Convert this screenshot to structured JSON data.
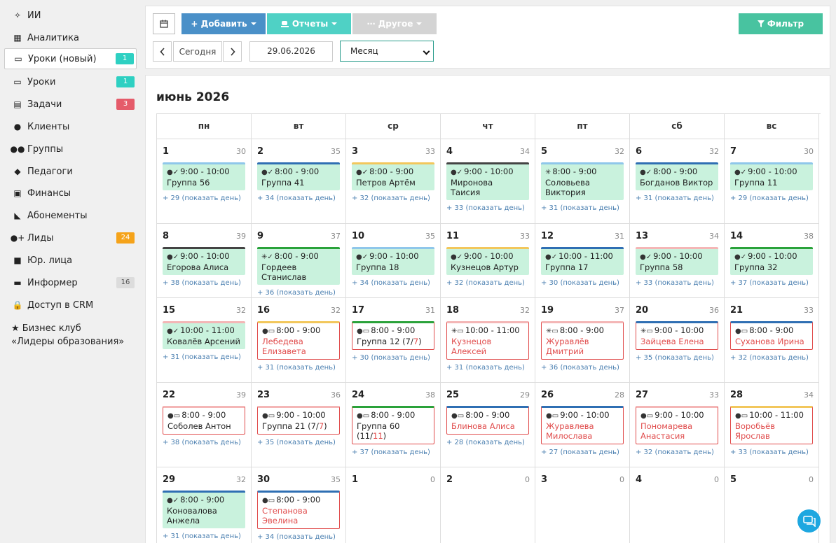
{
  "sidebar": {
    "items": [
      {
        "icon": "sparkles-icon",
        "glyph": "✧",
        "label": "ИИ"
      },
      {
        "icon": "map-icon",
        "glyph": "▦",
        "label": "Аналитика"
      },
      {
        "icon": "calendar-icon",
        "glyph": "▭",
        "label": "Уроки (новый)",
        "badge": "1",
        "badge_color": "teal"
      },
      {
        "icon": "calendar-icon",
        "glyph": "▭",
        "label": "Уроки",
        "badge": "1",
        "badge_color": "teal"
      },
      {
        "icon": "clipboard-icon",
        "glyph": "▤",
        "label": "Задачи",
        "badge": "3",
        "badge_color": "red"
      },
      {
        "icon": "user-icon",
        "glyph": "●",
        "label": "Клиенты"
      },
      {
        "icon": "users-icon",
        "glyph": "●●",
        "label": "Группы"
      },
      {
        "icon": "graduation-cap-icon",
        "glyph": "◆",
        "label": "Педагоги"
      },
      {
        "icon": "money-icon",
        "glyph": "▣",
        "label": "Финансы"
      },
      {
        "icon": "tag-icon",
        "glyph": "◣",
        "label": "Абонементы"
      },
      {
        "icon": "user-plus-icon",
        "glyph": "●+",
        "label": "Лиды",
        "badge": "24",
        "badge_color": "orange"
      },
      {
        "icon": "briefcase-icon",
        "glyph": "■",
        "label": "Юр. лица"
      },
      {
        "icon": "newspaper-icon",
        "glyph": "▬",
        "label": "Информер",
        "badge": "16",
        "badge_color": "gray"
      },
      {
        "icon": "lock-icon",
        "glyph": "🔒",
        "label": "Доступ в CRM"
      }
    ],
    "club_line1": "★ Бизнес клуб",
    "club_line2": "«Лидеры образования»"
  },
  "toolbar": {
    "add_label": "+ Добавить",
    "reports_label": "Отчеты",
    "other_label": "Другое",
    "filter_label": "Фильтр",
    "today_label": "Сегодня",
    "date_value": "29.06.2026",
    "view_value": "Месяц"
  },
  "calendar": {
    "title": "июнь 2026",
    "weekdays": [
      "пн",
      "вт",
      "ср",
      "чт",
      "пт",
      "сб",
      "вс"
    ],
    "colors": {
      "green": "#c9f2dd",
      "red": "#e04b4b",
      "link": "#4a7fb0"
    },
    "weeks": [
      [
        {
          "day": "1",
          "count": "30",
          "ev": {
            "icons": "●✓",
            "time": "9:00 - 10:00",
            "title": "Группа 56",
            "bar": "#8fc7ea",
            "st": "ok"
          },
          "more": "+ 29 (показать день)"
        },
        {
          "day": "2",
          "count": "35",
          "ev": {
            "icons": "●✓",
            "time": "8:00 - 9:00",
            "title": "Группа 41",
            "bar": "#2f6fb3",
            "st": "ok"
          },
          "more": "+ 34 (показать день)"
        },
        {
          "day": "3",
          "count": "33",
          "ev": {
            "icons": "●✓",
            "time": "8:00 - 9:00",
            "title": "Петров Артём",
            "bar": "#f2c75c",
            "st": "ok"
          },
          "more": "+ 32 (показать день)"
        },
        {
          "day": "4",
          "count": "34",
          "ev": {
            "icons": "●✓",
            "time": "9:00 - 10:00",
            "title": "Миронова Таисия",
            "bar": "#444444",
            "st": "ok"
          },
          "more": "+ 33 (показать день)"
        },
        {
          "day": "5",
          "count": "32",
          "ev": {
            "icons": "✳",
            "time": "8:00 - 9:00",
            "title": "Соловьева Виктория",
            "bar": "#8fc7ea",
            "st": "ok"
          },
          "more": "+ 31 (показать день)"
        },
        {
          "day": "6",
          "count": "32",
          "ev": {
            "icons": "●✓",
            "time": "8:00 - 9:00",
            "title": "Богданов Виктор",
            "bar": "#2f6fb3",
            "st": "ok"
          },
          "more": "+ 31 (показать день)"
        },
        {
          "day": "7",
          "count": "30",
          "ev": {
            "icons": "●✓",
            "time": "9:00 - 10:00",
            "title": "Группа 11",
            "bar": "#8fc7ea",
            "st": "ok"
          },
          "more": "+ 29 (показать день)"
        }
      ],
      [
        {
          "day": "8",
          "count": "39",
          "ev": {
            "icons": "●✓",
            "time": "9:00 - 10:00",
            "title": "Егорова Алиса",
            "bar": "#444444",
            "st": "ok"
          },
          "more": "+ 38 (показать день)"
        },
        {
          "day": "9",
          "count": "37",
          "ev": {
            "icons": "✳✓",
            "time": "8:00 - 9:00",
            "title": "Гордеев Станислав",
            "bar": "#2aa23a",
            "st": "ok"
          },
          "more": "+ 36 (показать день)"
        },
        {
          "day": "10",
          "count": "35",
          "ev": {
            "icons": "●✓",
            "time": "9:00 - 10:00",
            "title": "Группа 18",
            "bar": "#8fc7ea",
            "st": "ok"
          },
          "more": "+ 34 (показать день)"
        },
        {
          "day": "11",
          "count": "33",
          "ev": {
            "icons": "●✓",
            "time": "9:00 - 10:00",
            "title": "Кузнецов Артур",
            "bar": "#f2c75c",
            "st": "ok"
          },
          "more": "+ 32 (показать день)"
        },
        {
          "day": "12",
          "count": "31",
          "ev": {
            "icons": "●✓",
            "time": "10:00 - 11:00",
            "title": "Группа 17",
            "bar": "#2f6fb3",
            "st": "ok"
          },
          "more": "+ 30 (показать день)"
        },
        {
          "day": "13",
          "count": "34",
          "ev": {
            "icons": "●✓",
            "time": "9:00 - 10:00",
            "title": "Группа 58",
            "bar": "#f4b6b6",
            "st": "ok"
          },
          "more": "+ 33 (показать день)"
        },
        {
          "day": "14",
          "count": "38",
          "ev": {
            "icons": "●✓",
            "time": "9:00 - 10:00",
            "title": "Группа 32",
            "bar": "#2aa23a",
            "st": "ok"
          },
          "more": "+ 37 (показать день)"
        }
      ],
      [
        {
          "day": "15",
          "count": "32",
          "ev": {
            "icons": "●✓",
            "time": "10:00 - 11:00",
            "title": "Ковалёв Арсений",
            "bar": "#f4b6b6",
            "st": "ok"
          },
          "more": "+ 31 (показать день)"
        },
        {
          "day": "16",
          "count": "32",
          "ev": {
            "icons": "●▭",
            "time": "8:00 - 9:00",
            "title": "Лебедева Елизавета",
            "bar": "#f2c75c",
            "st": "plan",
            "person": true
          },
          "more": "+ 31 (показать день)"
        },
        {
          "day": "17",
          "count": "31",
          "ev": {
            "icons": "●▭",
            "time": "8:00 - 9:00",
            "title": "Группа 12 (7/",
            "hl": "7",
            "tail": ")",
            "bar": "#2aa23a",
            "st": "plan"
          },
          "more": "+ 30 (показать день)"
        },
        {
          "day": "18",
          "count": "32",
          "ev": {
            "icons": "✳▭",
            "time": "10:00 - 11:00",
            "title": "Кузнецов Алексей",
            "bar": "#f4b6b6",
            "st": "plan",
            "person": true
          },
          "more": "+ 31 (показать день)"
        },
        {
          "day": "19",
          "count": "37",
          "ev": {
            "icons": "✳▭",
            "time": "8:00 - 9:00",
            "title": "Журавлёв Дмитрий",
            "bar": "#f4b6b6",
            "st": "plan",
            "person": true
          },
          "more": "+ 36 (показать день)"
        },
        {
          "day": "20",
          "count": "36",
          "ev": {
            "icons": "✳▭",
            "time": "9:00 - 10:00",
            "title": "Зайцева Елена",
            "bar": "#2f6fb3",
            "st": "plan",
            "person": true
          },
          "more": "+ 35 (показать день)"
        },
        {
          "day": "21",
          "count": "33",
          "ev": {
            "icons": "●▭",
            "time": "8:00 - 9:00",
            "title": "Суханова Ирина",
            "bar": "#2f6fb3",
            "st": "plan",
            "person": true
          },
          "more": "+ 32 (показать день)"
        }
      ],
      [
        {
          "day": "22",
          "count": "39",
          "ev": {
            "icons": "●▭",
            "time": "8:00 - 9:00",
            "title": "Соболев Антон",
            "bar": "#f4b6b6",
            "st": "plan"
          },
          "more": "+ 38 (показать день)"
        },
        {
          "day": "23",
          "count": "36",
          "ev": {
            "icons": "●▭",
            "time": "9:00 - 10:00",
            "title": "Группа 21 (7/",
            "hl": "7",
            "tail": ")",
            "bar": "#f4b6b6",
            "st": "plan"
          },
          "more": "+ 35 (показать день)"
        },
        {
          "day": "24",
          "count": "38",
          "ev": {
            "icons": "●▭",
            "time": "8:00 - 9:00",
            "title": "Группа 60 (11/",
            "hl": "11",
            "tail": ")",
            "bar": "#2aa23a",
            "st": "plan"
          },
          "more": "+ 37 (показать день)"
        },
        {
          "day": "25",
          "count": "29",
          "ev": {
            "icons": "●▭",
            "time": "8:00 - 9:00",
            "title": "Блинова Алиса",
            "bar": "#2f6fb3",
            "st": "plan",
            "person": true
          },
          "more": "+ 28 (показать день)"
        },
        {
          "day": "26",
          "count": "28",
          "ev": {
            "icons": "●▭",
            "time": "9:00 - 10:00",
            "title": "Журавлева Милослава",
            "bar": "#2f6fb3",
            "st": "plan",
            "person": true
          },
          "more": "+ 27 (показать день)"
        },
        {
          "day": "27",
          "count": "33",
          "ev": {
            "icons": "●▭",
            "time": "9:00 - 10:00",
            "title": "Пономарева Анастасия",
            "bar": "#f4b6b6",
            "st": "plan",
            "person": true
          },
          "more": "+ 32 (показать день)"
        },
        {
          "day": "28",
          "count": "34",
          "ev": {
            "icons": "●▭",
            "time": "10:00 - 11:00",
            "title": "Воробьёв Ярослав",
            "bar": "#f2c75c",
            "st": "plan",
            "person": true
          },
          "more": "+ 33 (показать день)"
        }
      ],
      [
        {
          "day": "29",
          "count": "32",
          "ev": {
            "icons": "●✓",
            "time": "8:00 - 9:00",
            "title": "Коновалова Анжела",
            "bar": "#2f6fb3",
            "st": "ok"
          },
          "more": "+ 31 (показать день)"
        },
        {
          "day": "30",
          "count": "35",
          "ev": {
            "icons": "●▭",
            "time": "8:00 - 9:00",
            "title": "Степанова Эвелина",
            "bar": "#2f6fb3",
            "st": "plan",
            "person": true
          },
          "more": "+ 34 (показать день)"
        },
        {
          "day": "1",
          "count": "0"
        },
        {
          "day": "2",
          "count": "0"
        },
        {
          "day": "3",
          "count": "0"
        },
        {
          "day": "4",
          "count": "0"
        },
        {
          "day": "5",
          "count": "0"
        }
      ]
    ]
  }
}
